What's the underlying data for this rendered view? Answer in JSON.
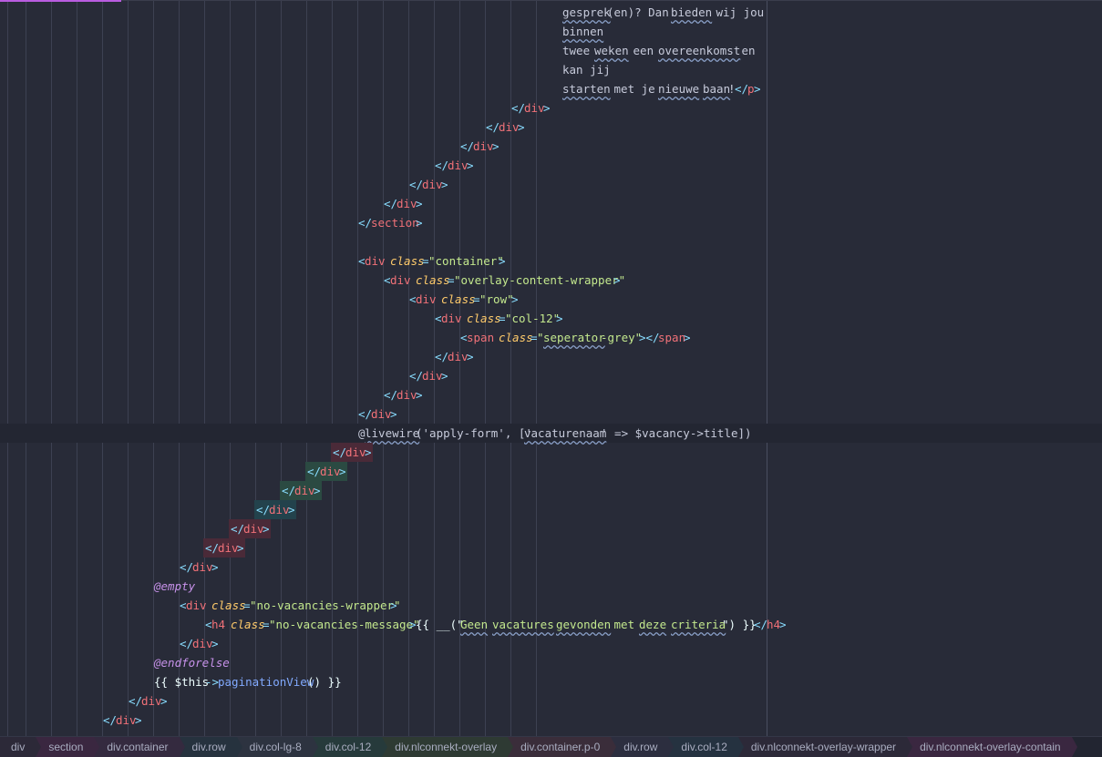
{
  "colors": {
    "background": "#282b38",
    "tag": "#f07178",
    "bracket": "#89ddff",
    "attribute": "#ffcb6b",
    "string": "#c3e88d",
    "directive": "#c792ea",
    "function": "#82aaff",
    "statusbar": "#222531"
  },
  "lines": [
    {
      "id": "l0",
      "tokens": [
        {
          "t": "gesprek",
          "c": "text",
          "u": true
        },
        {
          "t": "(en)? Dan ",
          "c": "text"
        },
        {
          "t": "bieden",
          "c": "text",
          "u": true
        },
        {
          "t": " wij jou",
          "c": "text"
        }
      ]
    },
    {
      "id": "l1",
      "tokens": [
        {
          "t": "binnen",
          "c": "text",
          "u": true
        }
      ]
    },
    {
      "id": "l2",
      "tokens": [
        {
          "t": "twee ",
          "c": "text"
        },
        {
          "t": "weken",
          "c": "text",
          "u": true
        },
        {
          "t": " een ",
          "c": "text"
        },
        {
          "t": "overeenkomst",
          "c": "text",
          "u": true
        },
        {
          "t": " en",
          "c": "text"
        }
      ]
    },
    {
      "id": "l3",
      "tokens": [
        {
          "t": "kan jij",
          "c": "text"
        }
      ]
    },
    {
      "id": "l4",
      "tokens": [
        {
          "t": "starten",
          "c": "text",
          "u": true
        },
        {
          "t": " met je ",
          "c": "text"
        },
        {
          "t": "nieuwe",
          "c": "text",
          "u": true
        },
        {
          "t": " ",
          "c": "text"
        },
        {
          "t": "baan",
          "c": "text",
          "u": true
        },
        {
          "t": "!",
          "c": "text"
        },
        {
          "t": "</",
          "c": "bracket"
        },
        {
          "t": "p",
          "c": "tag"
        },
        {
          "t": ">",
          "c": "bracket"
        }
      ]
    },
    {
      "id": "l5",
      "tokens": [
        {
          "t": "</",
          "c": "bracket"
        },
        {
          "t": "div",
          "c": "tag"
        },
        {
          "t": ">",
          "c": "bracket"
        }
      ]
    },
    {
      "id": "l6",
      "tokens": [
        {
          "t": "</",
          "c": "bracket"
        },
        {
          "t": "div",
          "c": "tag"
        },
        {
          "t": ">",
          "c": "bracket"
        }
      ]
    },
    {
      "id": "l7",
      "tokens": [
        {
          "t": "</",
          "c": "bracket"
        },
        {
          "t": "div",
          "c": "tag"
        },
        {
          "t": ">",
          "c": "bracket"
        }
      ]
    },
    {
      "id": "l8",
      "tokens": [
        {
          "t": "</",
          "c": "bracket"
        },
        {
          "t": "div",
          "c": "tag"
        },
        {
          "t": ">",
          "c": "bracket"
        }
      ]
    },
    {
      "id": "l9",
      "tokens": [
        {
          "t": "</",
          "c": "bracket"
        },
        {
          "t": "div",
          "c": "tag"
        },
        {
          "t": ">",
          "c": "bracket"
        }
      ]
    },
    {
      "id": "l10",
      "tokens": [
        {
          "t": "</",
          "c": "bracket"
        },
        {
          "t": "div",
          "c": "tag"
        },
        {
          "t": ">",
          "c": "bracket"
        }
      ]
    },
    {
      "id": "l11",
      "tokens": [
        {
          "t": "</",
          "c": "bracket"
        },
        {
          "t": "section",
          "c": "tag"
        },
        {
          "t": ">",
          "c": "bracket"
        }
      ]
    },
    {
      "id": "l12",
      "tokens": []
    },
    {
      "id": "l13",
      "tokens": [
        {
          "t": "<",
          "c": "bracket"
        },
        {
          "t": "div",
          "c": "tag"
        },
        {
          "t": " ",
          "c": "text"
        },
        {
          "t": "class",
          "c": "attr"
        },
        {
          "t": "=",
          "c": "bracket"
        },
        {
          "t": "\"container\"",
          "c": "str"
        },
        {
          "t": ">",
          "c": "bracket"
        }
      ]
    },
    {
      "id": "l14",
      "tokens": [
        {
          "t": "<",
          "c": "bracket"
        },
        {
          "t": "div",
          "c": "tag"
        },
        {
          "t": " ",
          "c": "text"
        },
        {
          "t": "class",
          "c": "attr"
        },
        {
          "t": "=",
          "c": "bracket"
        },
        {
          "t": "\"overlay-content-wrapper\"",
          "c": "str"
        },
        {
          "t": ">",
          "c": "bracket"
        }
      ]
    },
    {
      "id": "l15",
      "tokens": [
        {
          "t": "<",
          "c": "bracket"
        },
        {
          "t": "div",
          "c": "tag"
        },
        {
          "t": " ",
          "c": "text"
        },
        {
          "t": "class",
          "c": "attr"
        },
        {
          "t": "=",
          "c": "bracket"
        },
        {
          "t": "\"row\"",
          "c": "str"
        },
        {
          "t": ">",
          "c": "bracket"
        }
      ]
    },
    {
      "id": "l16",
      "tokens": [
        {
          "t": "<",
          "c": "bracket"
        },
        {
          "t": "div",
          "c": "tag"
        },
        {
          "t": " ",
          "c": "text"
        },
        {
          "t": "class",
          "c": "attr"
        },
        {
          "t": "=",
          "c": "bracket"
        },
        {
          "t": "\"col-12\"",
          "c": "str"
        },
        {
          "t": ">",
          "c": "bracket"
        }
      ]
    },
    {
      "id": "l17",
      "tokens": [
        {
          "t": "<",
          "c": "bracket"
        },
        {
          "t": "span",
          "c": "tag"
        },
        {
          "t": " ",
          "c": "text"
        },
        {
          "t": "class",
          "c": "attr"
        },
        {
          "t": "=",
          "c": "bracket"
        },
        {
          "t": "\"",
          "c": "str"
        },
        {
          "t": "seperator",
          "c": "str",
          "u": true
        },
        {
          "t": "-grey\"",
          "c": "str"
        },
        {
          "t": "></",
          "c": "bracket"
        },
        {
          "t": "span",
          "c": "tag"
        },
        {
          "t": ">",
          "c": "bracket"
        }
      ]
    },
    {
      "id": "l18",
      "tokens": [
        {
          "t": "</",
          "c": "bracket"
        },
        {
          "t": "div",
          "c": "tag"
        },
        {
          "t": ">",
          "c": "bracket"
        }
      ]
    },
    {
      "id": "l19",
      "tokens": [
        {
          "t": "</",
          "c": "bracket"
        },
        {
          "t": "div",
          "c": "tag"
        },
        {
          "t": ">",
          "c": "bracket"
        }
      ]
    },
    {
      "id": "l20",
      "tokens": [
        {
          "t": "</",
          "c": "bracket"
        },
        {
          "t": "div",
          "c": "tag"
        },
        {
          "t": ">",
          "c": "bracket"
        }
      ]
    },
    {
      "id": "l21",
      "tokens": [
        {
          "t": "</",
          "c": "bracket"
        },
        {
          "t": "div",
          "c": "tag"
        },
        {
          "t": ">",
          "c": "bracket"
        }
      ]
    },
    {
      "id": "l22",
      "tokens": [
        {
          "t": "@",
          "c": "text"
        },
        {
          "t": "livewire",
          "c": "text",
          "u": true
        },
        {
          "t": "('apply-form', ['",
          "c": "text"
        },
        {
          "t": "vacaturenaam",
          "c": "text",
          "u": true
        },
        {
          "t": "' => $vacancy->title])",
          "c": "text"
        }
      ]
    },
    {
      "id": "l23",
      "tokens": [
        {
          "t": "</",
          "c": "bracket"
        },
        {
          "t": "div",
          "c": "tag"
        },
        {
          "t": ">",
          "c": "bracket"
        }
      ]
    },
    {
      "id": "l24",
      "tokens": [
        {
          "t": "</",
          "c": "bracket"
        },
        {
          "t": "div",
          "c": "tag"
        },
        {
          "t": ">",
          "c": "bracket"
        }
      ]
    },
    {
      "id": "l25",
      "tokens": [
        {
          "t": "</",
          "c": "bracket"
        },
        {
          "t": "div",
          "c": "tag"
        },
        {
          "t": ">",
          "c": "bracket"
        }
      ]
    },
    {
      "id": "l26",
      "tokens": [
        {
          "t": "</",
          "c": "bracket"
        },
        {
          "t": "div",
          "c": "tag"
        },
        {
          "t": ">",
          "c": "bracket"
        }
      ]
    },
    {
      "id": "l27",
      "tokens": [
        {
          "t": "</",
          "c": "bracket"
        },
        {
          "t": "div",
          "c": "tag"
        },
        {
          "t": ">",
          "c": "bracket"
        }
      ]
    },
    {
      "id": "l28",
      "tokens": [
        {
          "t": "</",
          "c": "bracket"
        },
        {
          "t": "div",
          "c": "tag"
        },
        {
          "t": ">",
          "c": "bracket"
        }
      ]
    },
    {
      "id": "l29",
      "tokens": [
        {
          "t": "</",
          "c": "bracket"
        },
        {
          "t": "div",
          "c": "tag"
        },
        {
          "t": ">",
          "c": "bracket"
        }
      ]
    },
    {
      "id": "l30",
      "tokens": [
        {
          "t": "@empty",
          "c": "dir"
        }
      ]
    },
    {
      "id": "l31",
      "tokens": [
        {
          "t": "<",
          "c": "bracket"
        },
        {
          "t": "div",
          "c": "tag"
        },
        {
          "t": " ",
          "c": "text"
        },
        {
          "t": "class",
          "c": "attr"
        },
        {
          "t": "=",
          "c": "bracket"
        },
        {
          "t": "\"no-vacancies-wrapper\"",
          "c": "str"
        },
        {
          "t": ">",
          "c": "bracket"
        }
      ]
    },
    {
      "id": "l32",
      "tokens": [
        {
          "t": "<",
          "c": "bracket"
        },
        {
          "t": "h4",
          "c": "tag"
        },
        {
          "t": " ",
          "c": "text"
        },
        {
          "t": "class",
          "c": "attr"
        },
        {
          "t": "=",
          "c": "bracket"
        },
        {
          "t": "\"no-vacancies-message\"",
          "c": "str"
        },
        {
          "t": ">",
          "c": "bracket"
        },
        {
          "t": "{{ __(\"",
          "c": "var"
        },
        {
          "t": "Geen",
          "c": "str",
          "u": true
        },
        {
          "t": " ",
          "c": "str"
        },
        {
          "t": "vacatures",
          "c": "str",
          "u": true
        },
        {
          "t": " ",
          "c": "str"
        },
        {
          "t": "gevonden",
          "c": "str",
          "u": true
        },
        {
          "t": " met ",
          "c": "str"
        },
        {
          "t": "deze",
          "c": "str",
          "u": true
        },
        {
          "t": " ",
          "c": "str"
        },
        {
          "t": "criteria",
          "c": "str",
          "u": true
        },
        {
          "t": "\") }}",
          "c": "var"
        },
        {
          "t": "</",
          "c": "bracket"
        },
        {
          "t": "h4",
          "c": "tag"
        },
        {
          "t": ">",
          "c": "bracket"
        }
      ]
    },
    {
      "id": "l33",
      "tokens": [
        {
          "t": "</",
          "c": "bracket"
        },
        {
          "t": "div",
          "c": "tag"
        },
        {
          "t": ">",
          "c": "bracket"
        }
      ]
    },
    {
      "id": "l34",
      "tokens": [
        {
          "t": "@endforelse",
          "c": "dir"
        }
      ]
    },
    {
      "id": "l35",
      "tokens": [
        {
          "t": "{{ $this",
          "c": "var"
        },
        {
          "t": "->",
          "c": "op"
        },
        {
          "t": "paginationView",
          "c": "func"
        },
        {
          "t": "() }}",
          "c": "var"
        }
      ]
    },
    {
      "id": "l36",
      "tokens": [
        {
          "t": "</",
          "c": "bracket"
        },
        {
          "t": "div",
          "c": "tag"
        },
        {
          "t": ">",
          "c": "bracket"
        }
      ]
    },
    {
      "id": "l37",
      "tokens": [
        {
          "t": "</",
          "c": "bracket"
        },
        {
          "t": "div",
          "c": "tag"
        },
        {
          "t": ">",
          "c": "bracket"
        }
      ]
    }
  ],
  "statusbar": {
    "breadcrumbs": [
      "div",
      "section",
      "div.container",
      "div.row",
      "div.col-lg-8",
      "div.col-12",
      "div.nlconnekt-overlay",
      "div.container.p-0",
      "div.row",
      "div.col-12",
      "div.nlconnekt-overlay-wrapper",
      "div.nlconnekt-overlay-contain"
    ]
  }
}
